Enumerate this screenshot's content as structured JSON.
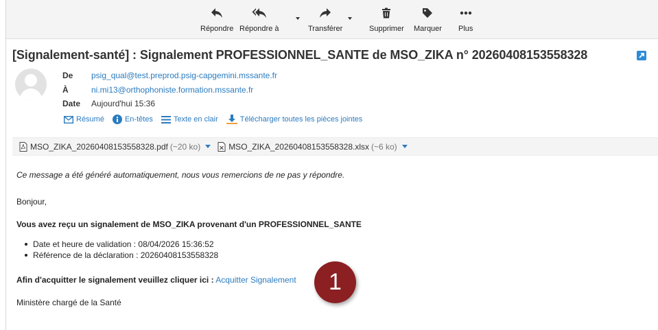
{
  "toolbar": {
    "reply": "Répondre",
    "reply_all": "Répondre à",
    "forward": "Transférer",
    "delete": "Supprimer",
    "mark": "Marquer",
    "more": "Plus"
  },
  "message": {
    "subject": "[Signalement-santé] : Signalement PROFESSIONNEL_SANTE de MSO_ZIKA n° 20260408153558328",
    "from_label": "De",
    "from": "psig_qual@test.preprod.psig-capgemini.mssante.fr",
    "to_label": "À",
    "to": "ni.mi13@orthophoniste.formation.mssante.fr",
    "date_label": "Date",
    "date": "Aujourd'hui 15:36"
  },
  "header_links": {
    "summary": "Résumé",
    "headers": "En-têtes",
    "plain_text": "Texte en clair",
    "download_all": "Télécharger toutes les pièces jointes"
  },
  "attachments": [
    {
      "name": "MSO_ZIKA_20260408153558328.pdf",
      "size": "(~20 ko)",
      "icon": "pdf-file-icon"
    },
    {
      "name": "MSO_ZIKA_20260408153558328.xlsx",
      "size": "(~6 ko)",
      "icon": "excel-file-icon"
    }
  ],
  "body": {
    "auto_notice": "Ce message a été généré automatiquement, nous vous remercions de ne pas y répondre.",
    "greeting": "Bonjour,",
    "intro": "Vous avez reçu un signalement de MSO_ZIKA provenant d'un PROFESSIONNEL_SANTE",
    "bullets": [
      "Date et heure de validation : 08/04/2026 15:36:52",
      "Référence de la déclaration : 20260408153558328"
    ],
    "ack_prefix": "Afin d'acquitter le signalement veuillez cliquer ici :",
    "ack_link": "Acquitter Signalement",
    "signature": "Ministère chargé de la Santé"
  },
  "annotation": {
    "step": "1"
  },
  "colors": {
    "link": "#2b7bbf",
    "badge": "#8b1f22",
    "toolbar_bg": "#f4f4f4"
  }
}
